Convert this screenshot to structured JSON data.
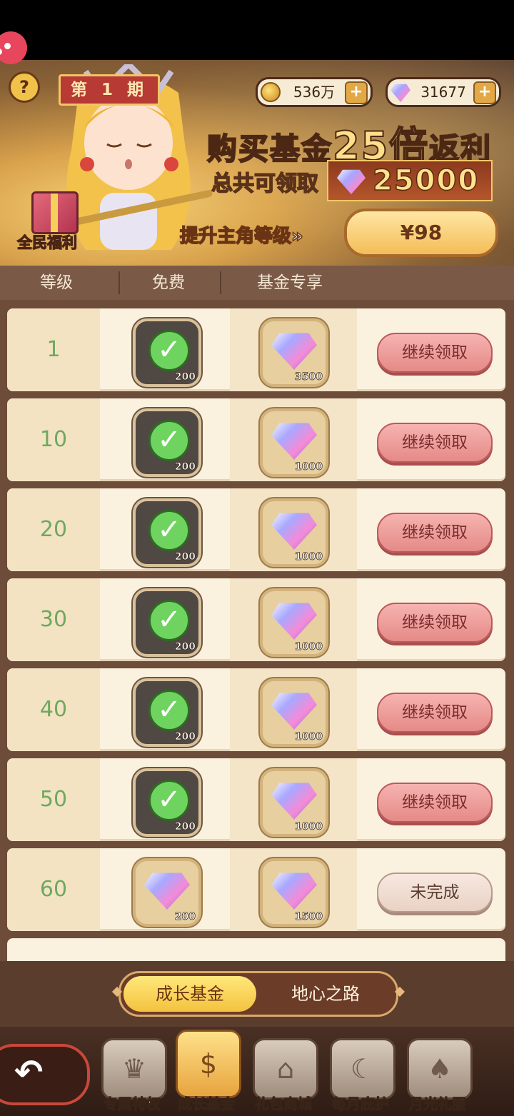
{
  "banner": {
    "period": "第 1 期",
    "coins": "536万",
    "gems": "31677",
    "headline_pre": "购买基金",
    "headline_mult": "25倍",
    "headline_post": "返利",
    "total_label": "总共可领取",
    "total_value": "25000",
    "upgrade_text": "提升主角等级»",
    "price": "¥98",
    "gift_label": "全民福利",
    "help": "?"
  },
  "columns": {
    "level": "等级",
    "free": "免费",
    "fund": "基金专享"
  },
  "rows": [
    {
      "level": "1",
      "free_amount": "200",
      "free_claimed": true,
      "fund_amount": "3500",
      "action": "继续领取"
    },
    {
      "level": "10",
      "free_amount": "200",
      "free_claimed": true,
      "fund_amount": "1000",
      "action": "继续领取"
    },
    {
      "level": "20",
      "free_amount": "200",
      "free_claimed": true,
      "fund_amount": "1000",
      "action": "继续领取"
    },
    {
      "level": "30",
      "free_amount": "200",
      "free_claimed": true,
      "fund_amount": "1000",
      "action": "继续领取"
    },
    {
      "level": "40",
      "free_amount": "200",
      "free_claimed": true,
      "fund_amount": "1000",
      "action": "继续领取"
    },
    {
      "level": "50",
      "free_amount": "200",
      "free_claimed": true,
      "fund_amount": "1000",
      "action": "继续领取"
    },
    {
      "level": "60",
      "free_amount": "200",
      "free_claimed": false,
      "fund_amount": "1500",
      "action": "未完成"
    }
  ],
  "tabs": {
    "active": "成长基金",
    "inactive": "地心之路"
  },
  "nav": {
    "items": [
      {
        "label": "专属特权",
        "icon": "crown-icon"
      },
      {
        "label": "成长基金",
        "icon": "growth-fund-icon"
      },
      {
        "label": "礼包商城",
        "icon": "shop-icon"
      },
      {
        "label": "每月庇护",
        "icon": "moon-icon"
      },
      {
        "label": "月光礼服",
        "icon": "dress-icon"
      }
    ],
    "back": "back-arrow-icon"
  },
  "colors": {
    "accent": "#f4c23e",
    "claim": "#e58a87",
    "level_text": "#6fa85f"
  }
}
